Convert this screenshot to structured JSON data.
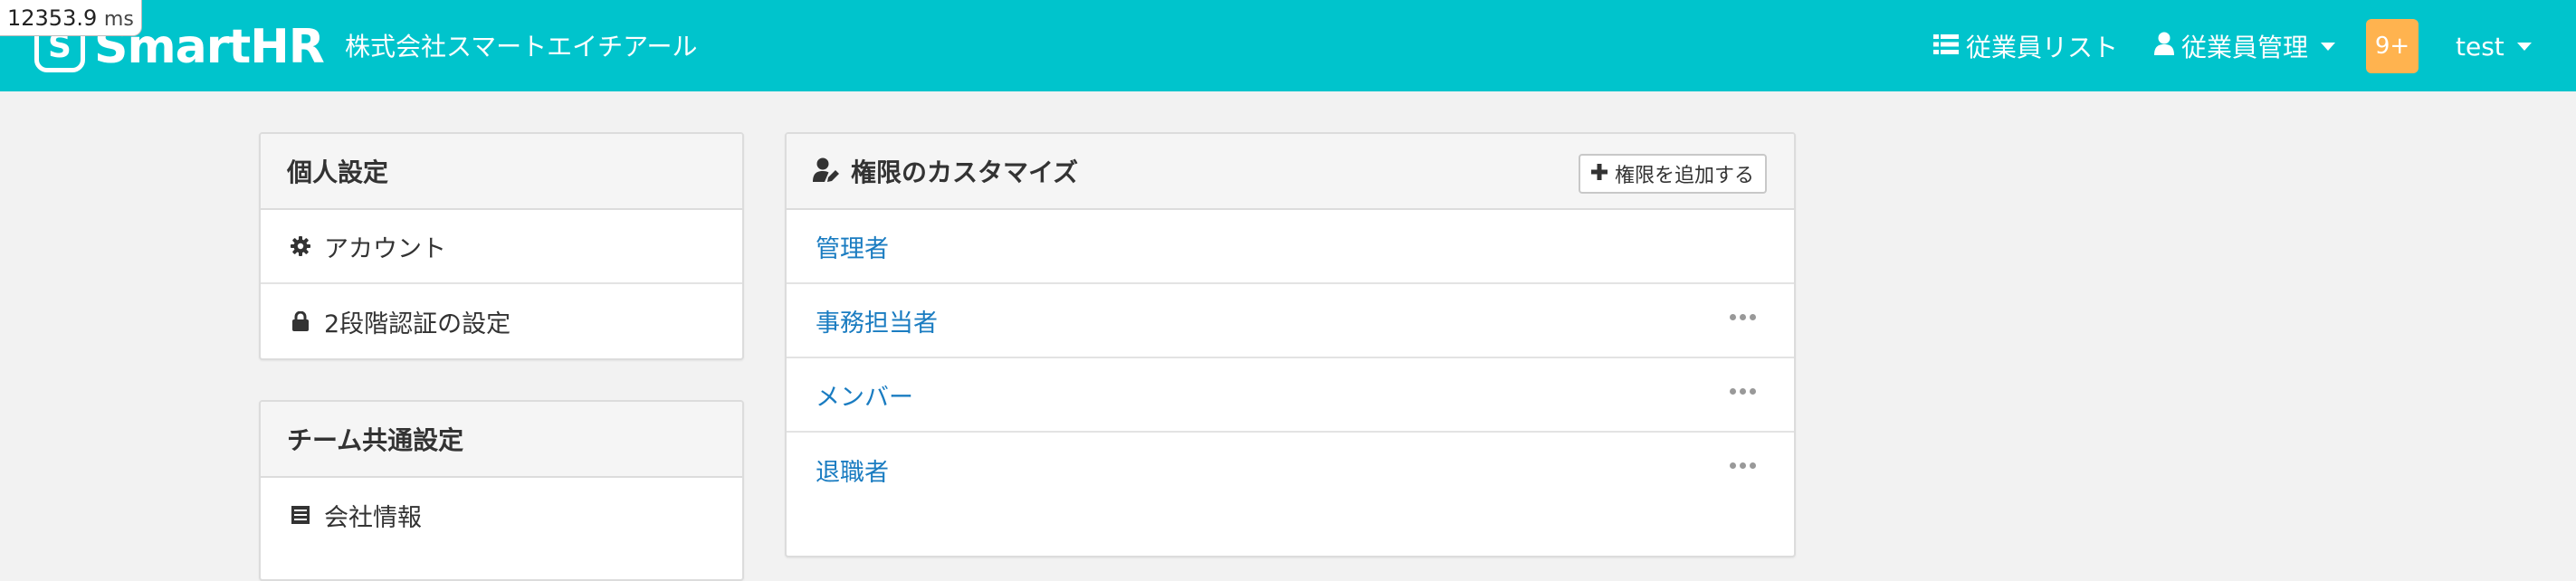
{
  "timing": {
    "value": "12353.9",
    "unit": "ms"
  },
  "header": {
    "logo_text": "SmartHR",
    "logo_mark": "S",
    "company": "株式会社スマートエイチアール",
    "nav": {
      "employee_list": "従業員リスト",
      "employee_mgmt": "従業員管理",
      "notifications": "9+",
      "user": "test"
    }
  },
  "sidebar": {
    "personal": {
      "title": "個人設定",
      "items": [
        {
          "label": "アカウント",
          "icon": "gear-icon"
        },
        {
          "label": "2段階認証の設定",
          "icon": "lock-icon"
        }
      ]
    },
    "team": {
      "title": "チーム共通設定",
      "items": [
        {
          "label": "会社情報",
          "icon": "list-icon"
        }
      ]
    }
  },
  "main": {
    "title": "権限のカスタマイズ",
    "add_button": "権限を追加する",
    "roles": [
      {
        "label": "管理者",
        "has_menu": false
      },
      {
        "label": "事務担当者",
        "has_menu": true
      },
      {
        "label": "メンバー",
        "has_menu": true
      },
      {
        "label": "退職者",
        "has_menu": true
      }
    ]
  },
  "colors": {
    "brand": "#00c4cc",
    "badge": "#ffb34f",
    "link": "#1a7cc1"
  }
}
